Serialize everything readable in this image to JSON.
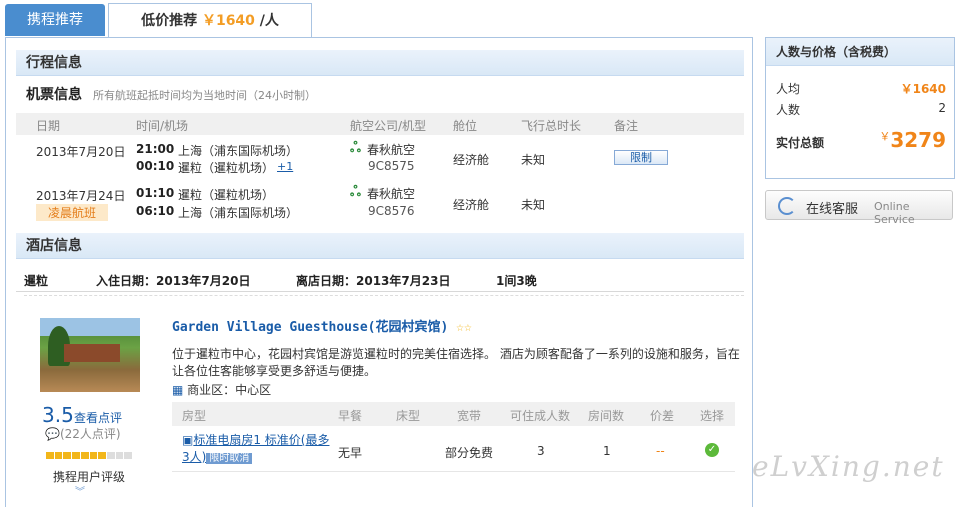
{
  "tabs": {
    "ctrip_recommend": "携程推荐",
    "low_price_label": "低价推荐",
    "low_price_value": "￥1640",
    "low_price_unit": "/人"
  },
  "itinerary": {
    "title": "行程信息",
    "flight_title": "机票信息",
    "flight_note": "所有航班起抵时间均为当地时间（24小时制）",
    "columns": [
      "日期",
      "时间/机场",
      "航空公司/机型",
      "舱位",
      "飞行总时长",
      "备注"
    ],
    "flights": [
      {
        "date": "2013年7月20日",
        "dep_time": "21:00",
        "dep_airport": "上海（浦东国际机场）",
        "arr_time": "00:10",
        "arr_airport": "暹粒（暹粒机场）",
        "arr_plus": "+1",
        "airline": "春秋航空",
        "flight_no": "9C8575",
        "cabin": "经济舱",
        "duration": "未知",
        "remark": "限制"
      },
      {
        "date": "2013年7月24日",
        "badge": "凌晨航班",
        "dep_time": "01:10",
        "dep_airport": "暹粒（暹粒机场）",
        "arr_time": "06:10",
        "arr_airport": "上海（浦东国际机场）",
        "airline": "春秋航空",
        "flight_no": "9C8576",
        "cabin": "经济舱",
        "duration": "未知"
      }
    ]
  },
  "hotel": {
    "title": "酒店信息",
    "city": "暹粒",
    "checkin": "入住日期：2013年7月20日",
    "checkout": "离店日期：2013年7月23日",
    "rooms_nights": "1间3晚",
    "name": "Garden Village Guesthouse(花园村宾馆)",
    "stars": "☆☆",
    "description": "位于暹粒市中心，花园村宾馆是游览暹粒时的完美住宿选择。 酒店为顾客配备了一系列的设施和服务，旨在让各位住客能够享受更多舒适与便捷。",
    "district": "商业区：中心区",
    "score": "3.5",
    "score_link": "查看点评",
    "review_count": "(22人点评)",
    "rating_label": "携程用户评级",
    "rating_level": 0.7,
    "room_columns": [
      "房型",
      "早餐",
      "床型",
      "宽带",
      "可住成人数",
      "房间数",
      "价差",
      "选择"
    ],
    "room": {
      "name": "标准电扇房1 标准价(最多3人)",
      "cancel_badge": "限时取消",
      "breakfast": "无早",
      "bed": "",
      "broadband": "部分免费",
      "adults": "3",
      "rooms": "1",
      "price_diff": "--"
    }
  },
  "side": {
    "title": "人数与价格（含税费）",
    "per_person_label": "人均",
    "per_person_value": "￥1640",
    "people_label": "人数",
    "people_value": "2",
    "total_label": "实付总额",
    "total_currency": "￥",
    "total_value": "3279",
    "service_cn": "在线客服",
    "service_en": "Online Service"
  },
  "watermark": "eLvXing.net",
  "colors": {
    "accent": "#f08519",
    "link": "#1a5ca8",
    "tab_active": "#4a8dcf"
  }
}
